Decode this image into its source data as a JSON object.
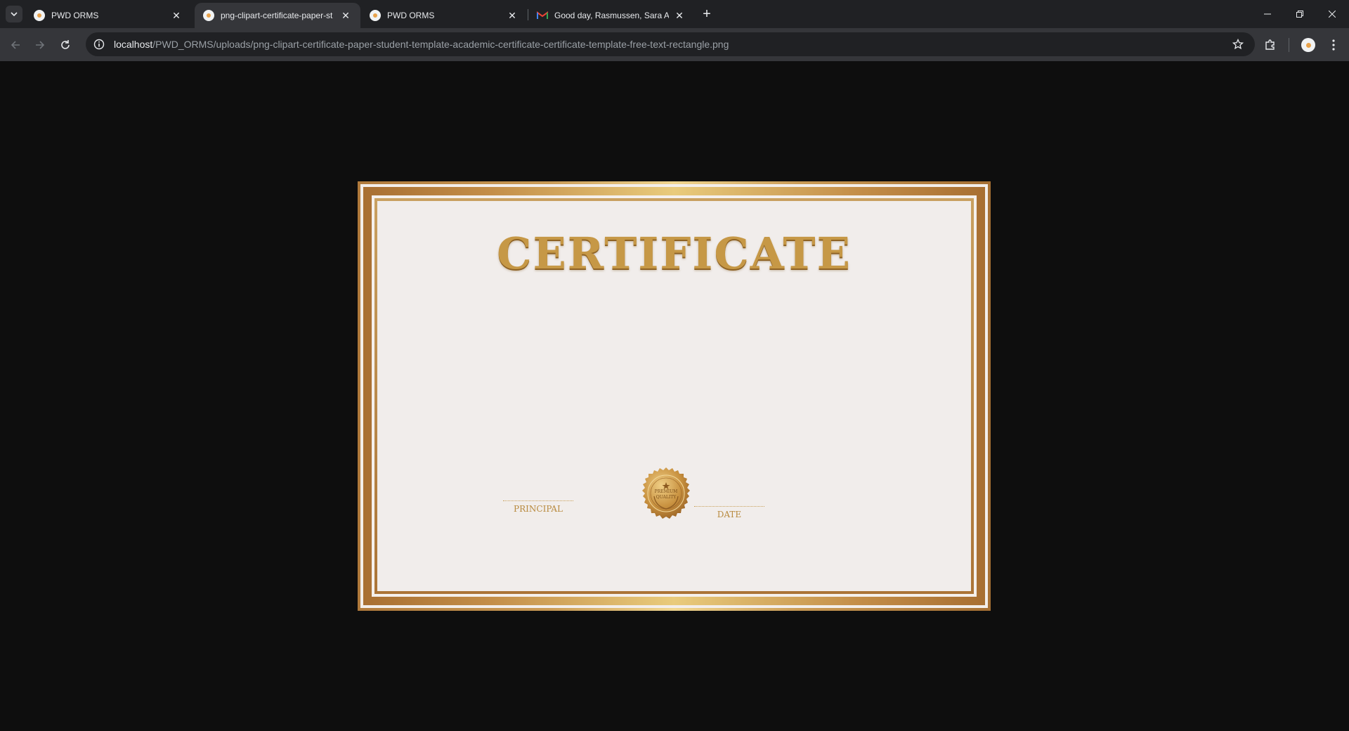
{
  "browser": {
    "tabs": [
      {
        "title": "PWD ORMS",
        "active": false,
        "favicon": "app-favicon"
      },
      {
        "title": "png-clipart-certificate-paper-st",
        "active": true,
        "favicon": "app-favicon"
      },
      {
        "title": "PWD ORMS",
        "active": false,
        "favicon": "app-favicon"
      },
      {
        "title": "Good day, Rasmussen, Sara Aul",
        "active": false,
        "favicon": "gmail-icon"
      }
    ],
    "url": {
      "host": "localhost",
      "path": "/PWD_ORMS/uploads/png-clipart-certificate-paper-student-template-academic-certificate-certificate-template-free-text-rectangle.png"
    }
  },
  "certificate": {
    "title": "CERTIFICATE",
    "seal_line1": "PREMIUM",
    "seal_line2": "QUALITY",
    "principal_label": "PRINCIPAL",
    "date_label": "DATE"
  },
  "colors": {
    "page_bg": "#0e0e0e",
    "gold_light": "#f0d690",
    "gold_dark": "#a86f32",
    "paper": "#f1edeb"
  }
}
